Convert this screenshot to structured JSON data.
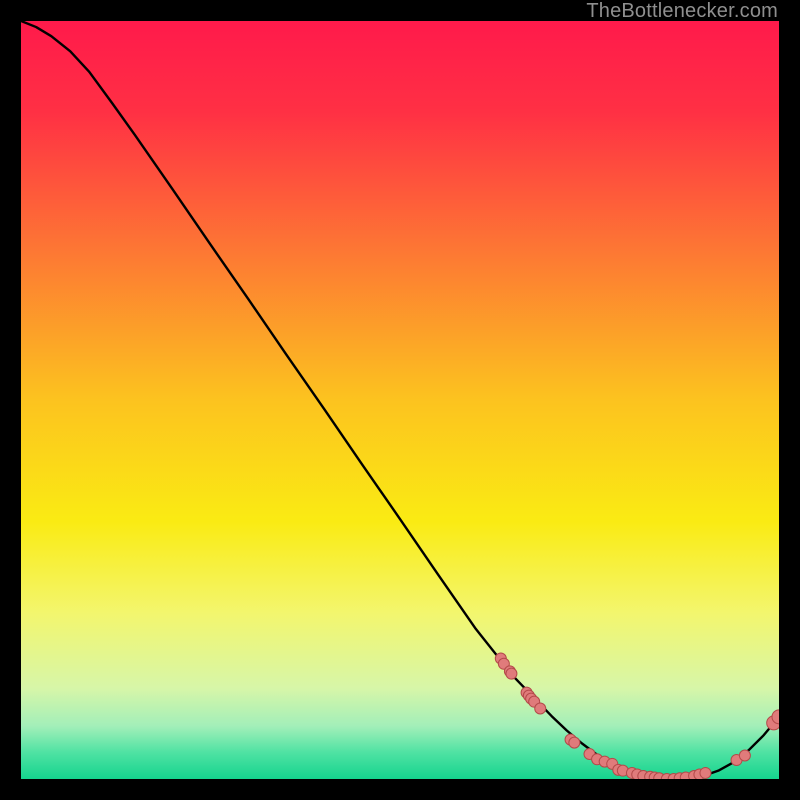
{
  "attribution": "TheBottlenecker.com",
  "chart_data": {
    "type": "line",
    "title": "",
    "xlabel": "",
    "ylabel": "",
    "xlim": [
      0,
      100
    ],
    "ylim": [
      0,
      100
    ],
    "gradient_stops": [
      {
        "pos": 0.0,
        "color": "#ff1a4b"
      },
      {
        "pos": 0.12,
        "color": "#ff3044"
      },
      {
        "pos": 0.3,
        "color": "#fd7634"
      },
      {
        "pos": 0.5,
        "color": "#fcc31f"
      },
      {
        "pos": 0.66,
        "color": "#faeb13"
      },
      {
        "pos": 0.78,
        "color": "#f3f66d"
      },
      {
        "pos": 0.88,
        "color": "#d7f6a8"
      },
      {
        "pos": 0.93,
        "color": "#a3efb9"
      },
      {
        "pos": 0.965,
        "color": "#4fe2a3"
      },
      {
        "pos": 1.0,
        "color": "#15d48e"
      }
    ],
    "series": [
      {
        "name": "curve",
        "color": "#000000",
        "x": [
          0.0,
          2.0,
          4.0,
          6.5,
          9.0,
          12.0,
          15.0,
          20.0,
          25.0,
          30.0,
          35.0,
          40.0,
          45.0,
          50.0,
          55.0,
          60.0,
          65.0,
          70.0,
          72.0,
          74.0,
          76.0,
          78.0,
          80.0,
          82.0,
          84.0,
          86.0,
          88.0,
          90.0,
          92.0,
          94.0,
          96.0,
          98.0,
          100.0
        ],
        "y": [
          100.0,
          99.2,
          98.0,
          96.0,
          93.3,
          89.2,
          85.0,
          77.8,
          70.5,
          63.3,
          56.0,
          48.8,
          41.5,
          34.3,
          27.0,
          19.8,
          13.5,
          8.3,
          6.4,
          4.7,
          3.2,
          2.0,
          1.1,
          0.5,
          0.1,
          0.0,
          0.1,
          0.4,
          1.1,
          2.2,
          3.8,
          5.8,
          8.2
        ]
      }
    ],
    "scatter": [
      {
        "x": 63.3,
        "y": 15.9
      },
      {
        "x": 63.7,
        "y": 15.2
      },
      {
        "x": 64.5,
        "y": 14.2
      },
      {
        "x": 64.7,
        "y": 13.9
      },
      {
        "x": 66.7,
        "y": 11.4
      },
      {
        "x": 67.0,
        "y": 11.0
      },
      {
        "x": 67.3,
        "y": 10.6
      },
      {
        "x": 67.7,
        "y": 10.2
      },
      {
        "x": 68.5,
        "y": 9.3
      },
      {
        "x": 72.5,
        "y": 5.2
      },
      {
        "x": 73.0,
        "y": 4.8
      },
      {
        "x": 75.0,
        "y": 3.3
      },
      {
        "x": 76.0,
        "y": 2.6
      },
      {
        "x": 77.0,
        "y": 2.3
      },
      {
        "x": 78.0,
        "y": 2.0
      },
      {
        "x": 78.8,
        "y": 1.2
      },
      {
        "x": 79.4,
        "y": 1.1
      },
      {
        "x": 80.6,
        "y": 0.8
      },
      {
        "x": 81.3,
        "y": 0.6
      },
      {
        "x": 82.1,
        "y": 0.4
      },
      {
        "x": 83.0,
        "y": 0.3
      },
      {
        "x": 83.6,
        "y": 0.2
      },
      {
        "x": 84.2,
        "y": 0.1
      },
      {
        "x": 85.2,
        "y": 0.0
      },
      {
        "x": 86.1,
        "y": 0.0
      },
      {
        "x": 86.9,
        "y": 0.1
      },
      {
        "x": 87.7,
        "y": 0.2
      },
      {
        "x": 88.8,
        "y": 0.4
      },
      {
        "x": 89.5,
        "y": 0.6
      },
      {
        "x": 90.3,
        "y": 0.8
      },
      {
        "x": 94.4,
        "y": 2.5
      },
      {
        "x": 95.5,
        "y": 3.1
      },
      {
        "x": 99.3,
        "y": 7.4
      },
      {
        "x": 100.0,
        "y": 8.2
      }
    ],
    "scatter_style": {
      "fill": "#e07b7b",
      "stroke": "#b44a4a",
      "radius_small": 5.5,
      "radius_large": 7.0
    }
  }
}
